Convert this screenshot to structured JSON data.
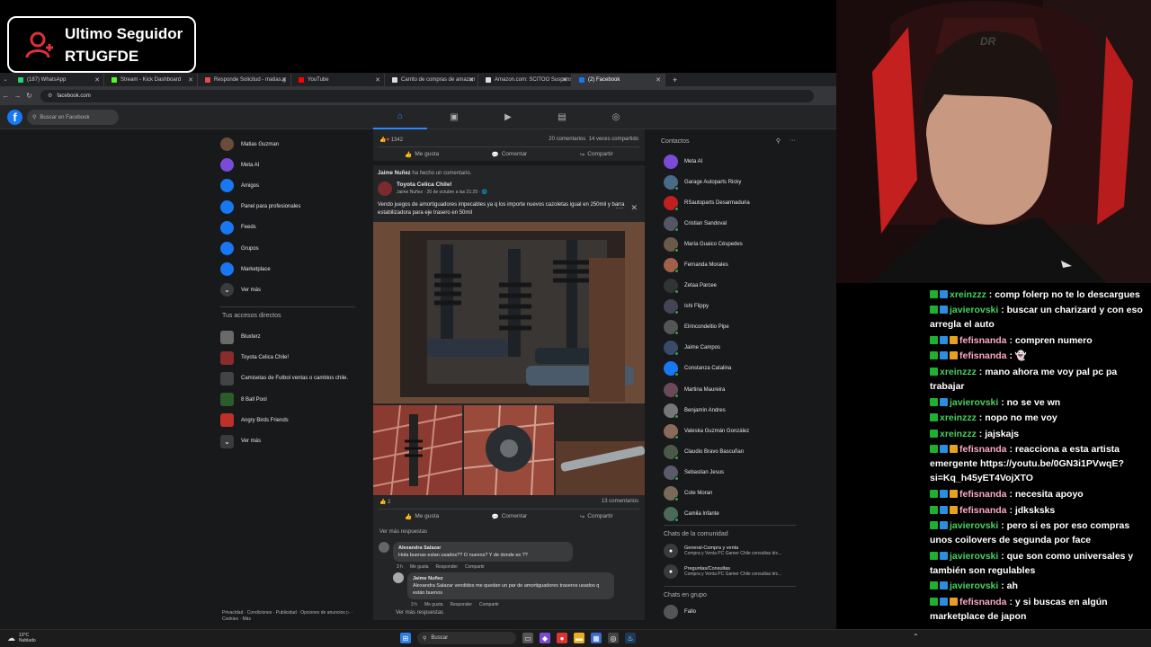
{
  "overlay": {
    "line1": "Ultimo Seguidor",
    "line2": "RTUGFDE"
  },
  "browser": {
    "tabs": [
      {
        "label": "(187) WhatsApp",
        "color": "#25d366",
        "active": false
      },
      {
        "label": "Stream - Kick Dashboard",
        "color": "#53fc18",
        "active": false
      },
      {
        "label": "Responde Solicitud - matias.g",
        "color": "#e34b4b",
        "active": false
      },
      {
        "label": "YouTube",
        "color": "#ff0000",
        "active": false
      },
      {
        "label": "Carrito de compras de amazon",
        "color": "#dddddd",
        "active": false
      },
      {
        "label": "Amazon.com: SCITOO Suspens",
        "color": "#dddddd",
        "active": false
      },
      {
        "label": "(2) Facebook",
        "color": "#1877f2",
        "active": true
      }
    ],
    "url": "facebook.com"
  },
  "fb": {
    "search_placeholder": "Buscar en Facebook",
    "left_menu": [
      {
        "label": "Matias Guzman",
        "color": "#6b4b3a",
        "icon": "user-avatar"
      },
      {
        "label": "Meta AI",
        "color": "#7b4bd8",
        "icon": "meta-ai-icon"
      },
      {
        "label": "Amigos",
        "color": "#1877f2",
        "icon": "friends-icon"
      },
      {
        "label": "Panel para profesionales",
        "color": "#1877f2",
        "icon": "dashboard-icon"
      },
      {
        "label": "Feeds",
        "color": "#1877f2",
        "icon": "feeds-icon"
      },
      {
        "label": "Grupos",
        "color": "#1877f2",
        "icon": "groups-icon"
      },
      {
        "label": "Marketplace",
        "color": "#1877f2",
        "icon": "marketplace-icon"
      },
      {
        "label": "Ver más",
        "color": "#3a3b3c",
        "icon": "chevron-down-icon"
      }
    ],
    "shortcuts_title": "Tus accesos directos",
    "shortcuts": [
      {
        "label": "Bluxterz",
        "color": "#6a6a6a"
      },
      {
        "label": "Toyota Celica Chile!",
        "color": "#8a2c2c"
      },
      {
        "label": "Camisetas de Futbol ventas o cambios chile.",
        "color": "#444"
      },
      {
        "label": "8 Ball Pool",
        "color": "#2b5d2b"
      },
      {
        "label": "Angry Birds Friends",
        "color": "#c0302a"
      },
      {
        "label": "Ver más",
        "color": "#3a3b3c"
      }
    ],
    "footer": "Privacidad · Condiciones · Publicidad · Opciones de anuncios ▷ · Cookies · Más",
    "prev_post": {
      "reactions": "1342",
      "comments": "20 comentarios",
      "shares": "14 veces compartido"
    },
    "actions": {
      "like": "Me gusta",
      "comment": "Comentar",
      "share": "Compartir"
    },
    "comment_note": {
      "name": "Jaime Nuñez",
      "text": "ha hecho un comentario."
    },
    "post": {
      "group": "Toyota Celica Chile!",
      "meta": "Jaime Nuñez · 20 de octubre a las 21:29 · 🌐",
      "text": "Vendo juegos de amortiguadores impecables ya q los importe nuevos cazoletas igual en 250mil y barra estabilizadora para eje trasero en 50mil",
      "reactions": "2",
      "comments": "13 comentarios",
      "see_more": "Ver más respuestas",
      "replies": [
        {
          "name": "Alexandra Salazar",
          "text": "Hola buenas estan usados?? O nuevos? Y de donde es ??",
          "time": "3 h",
          "like": "Me gusta",
          "reply": "Responder",
          "share": "Compartir"
        },
        {
          "name": "Jaime Nuñez",
          "text": "Alexandra Salazar vendidos me quedan un par de amortiguadores traseros usados q están buenos",
          "time": "3 h",
          "like": "Me gusta",
          "reply": "Responder",
          "share": "Compartir"
        }
      ],
      "see_more_2": "Ver más respuestas"
    },
    "contacts_title": "Contactos",
    "contacts": [
      {
        "name": "Meta AI",
        "color": "#7b4bd8",
        "online": false
      },
      {
        "name": "Garage Autoparts Ricky",
        "color": "#4a6a8a",
        "online": true
      },
      {
        "name": "RSautoparts Desarmaduria",
        "color": "#c02020",
        "online": true
      },
      {
        "name": "Cristian Sandoval",
        "color": "#556",
        "online": true
      },
      {
        "name": "María Guaico Céspedes",
        "color": "#6a5a4a",
        "online": true
      },
      {
        "name": "Fernanda Morales",
        "color": "#a0604a",
        "online": true
      },
      {
        "name": "Zetaa Parcee",
        "color": "#333",
        "online": true
      },
      {
        "name": "Ishi Flippy",
        "color": "#445",
        "online": true
      },
      {
        "name": "Elrincondeltio Pipe",
        "color": "#555",
        "online": true
      },
      {
        "name": "Jaime Campos",
        "color": "#3a4a6a",
        "online": true
      },
      {
        "name": "Constanza Catalina",
        "color": "#1877f2",
        "online": true
      },
      {
        "name": "Martina Maureira",
        "color": "#6a4a5a",
        "online": true
      },
      {
        "name": "Benjamín Andres",
        "color": "#777",
        "online": true
      },
      {
        "name": "Valeska Guzmán González",
        "color": "#8a6a5a",
        "online": true
      },
      {
        "name": "Claudio Bravo Bascuñan",
        "color": "#4a5a4a",
        "online": true
      },
      {
        "name": "Sebastian Jesus",
        "color": "#5a5a6a",
        "online": true
      },
      {
        "name": "Cote Moran",
        "color": "#7a6a5a",
        "online": true
      },
      {
        "name": "Camila Infante",
        "color": "#4a6a5a",
        "online": true
      }
    ],
    "community_title": "Chats de la comunidad",
    "community": [
      {
        "name": "General-Compra y venta",
        "sub": "Compra y Venta PC Gamer Chile consultas téc..."
      },
      {
        "name": "Preguntas/Consultas",
        "sub": "Compra y Venta PC Gamer Chile consultas téc..."
      }
    ],
    "groups_title": "Chats en grupo",
    "groups": [
      {
        "name": "Fallo"
      }
    ]
  },
  "chat": [
    {
      "user": "xreinzzz",
      "color": "#46d160",
      "badges": [
        "b1",
        "b2"
      ],
      "msg": ": comp folerp no te lo descargues"
    },
    {
      "user": "javierovski",
      "color": "#46d160",
      "badges": [
        "b1",
        "b2"
      ],
      "msg": ": buscar un charizard y con eso arregla el auto"
    },
    {
      "user": "fefisnanda",
      "color": "#f9a8c4",
      "badges": [
        "b1",
        "b2",
        "b3"
      ],
      "msg": ": compren numero"
    },
    {
      "user": "fefisnanda",
      "color": "#f9a8c4",
      "badges": [
        "b1",
        "b2",
        "b3"
      ],
      "msg": ": 👻"
    },
    {
      "user": "xreinzzz",
      "color": "#46d160",
      "badges": [
        "b1"
      ],
      "msg": ": mano ahora me voy pal pc pa trabajar"
    },
    {
      "user": "javierovski",
      "color": "#46d160",
      "badges": [
        "b1",
        "b2"
      ],
      "msg": ": no se ve wn"
    },
    {
      "user": "xreinzzz",
      "color": "#46d160",
      "badges": [
        "b1"
      ],
      "msg": ": nopo no me voy"
    },
    {
      "user": "xreinzzz",
      "color": "#46d160",
      "badges": [
        "b1"
      ],
      "msg": ": jajskajs"
    },
    {
      "user": "fefisnanda",
      "color": "#f9a8c4",
      "badges": [
        "b1",
        "b2",
        "b3"
      ],
      "msg": ": reacciona a esta artista emergente https://youtu.be/0GN3i1PVwqE?si=Kq_h45yET4VojXTO"
    },
    {
      "user": "fefisnanda",
      "color": "#f9a8c4",
      "badges": [
        "b1",
        "b2",
        "b3"
      ],
      "msg": ": necesita apoyo"
    },
    {
      "user": "fefisnanda",
      "color": "#f9a8c4",
      "badges": [
        "b1",
        "b2",
        "b3"
      ],
      "msg": ": jdksksks"
    },
    {
      "user": "javierovski",
      "color": "#46d160",
      "badges": [
        "b1",
        "b2"
      ],
      "msg": ": pero si es por eso compras unos coilovers de segunda por face"
    },
    {
      "user": "javierovski",
      "color": "#46d160",
      "badges": [
        "b1",
        "b2"
      ],
      "msg": ": que son como universales y también son regulables"
    },
    {
      "user": "javierovski",
      "color": "#46d160",
      "badges": [
        "b1",
        "b2"
      ],
      "msg": ": ah"
    },
    {
      "user": "fefisnanda",
      "color": "#f9a8c4",
      "badges": [
        "b1",
        "b2",
        "b3"
      ],
      "msg": ": y si buscas en algún marketplace de japon"
    }
  ],
  "taskbar": {
    "weather_temp": "13°C",
    "weather_desc": "Nublado",
    "search": "Buscar"
  }
}
